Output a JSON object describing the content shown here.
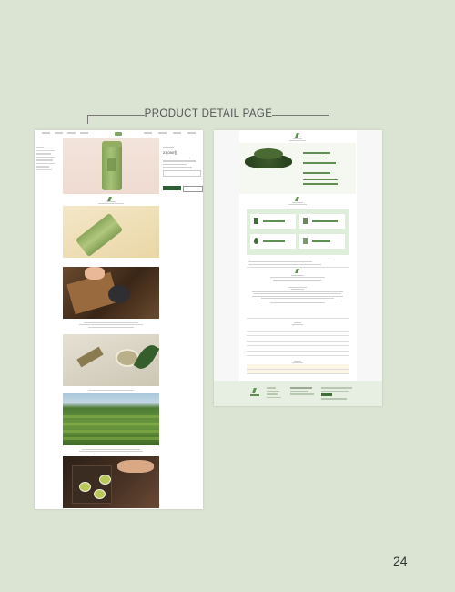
{
  "page": {
    "title": "PRODUCT DETAIL PAGE",
    "page_number": "24"
  },
  "panel_left": {
    "product_price": "23,000원"
  },
  "colors": {
    "background": "#dbe3d3",
    "accent_green": "#2f5d36",
    "light_green": "#dfeeda"
  }
}
